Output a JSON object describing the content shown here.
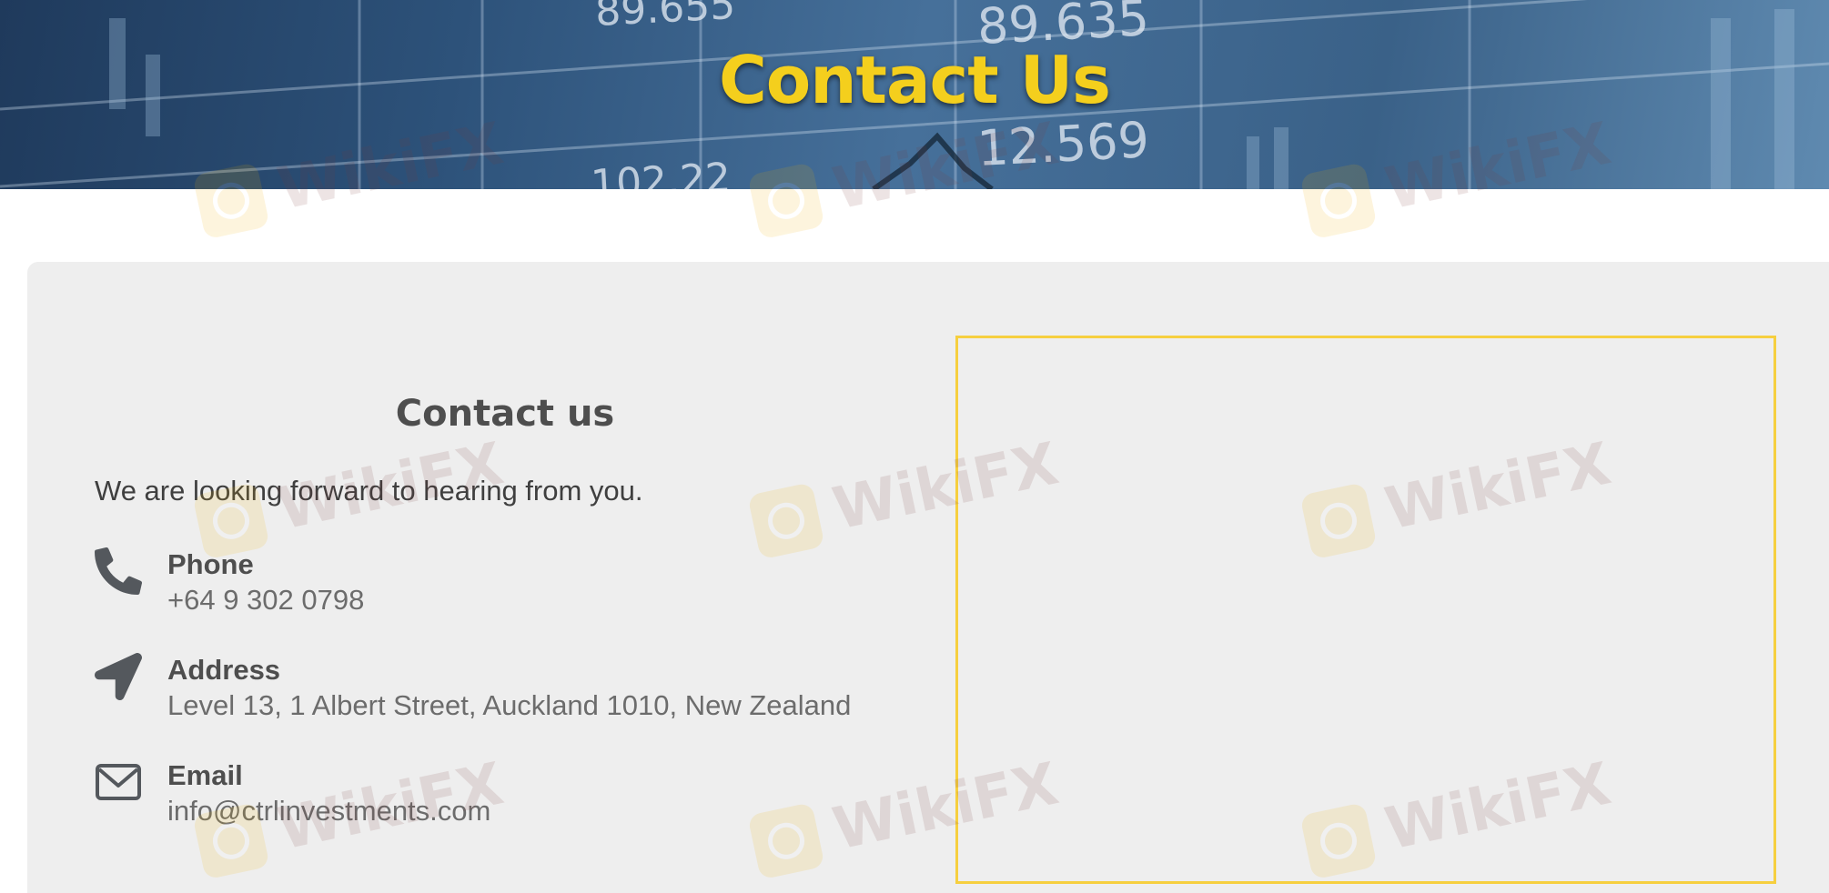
{
  "hero": {
    "title": "Contact Us",
    "background_numbers": [
      "89.655",
      "89.635",
      "12.569",
      "102.22"
    ]
  },
  "contact": {
    "heading": "Contact us",
    "intro": "We are looking forward to hearing from you.",
    "items": [
      {
        "label": "Phone",
        "value": "+64 9 302 0798",
        "icon": "phone-icon"
      },
      {
        "label": "Address",
        "value": "Level 13, 1 Albert Street, Auckland 1010, New Zealand",
        "icon": "location-arrow-icon"
      },
      {
        "label": "Email",
        "value": "info@ctrlinvestments.com",
        "icon": "envelope-icon"
      }
    ]
  },
  "watermark": {
    "text": "WikiFX"
  },
  "colors": {
    "title_yellow": "#f4cf1d",
    "card_background": "#eeeeee",
    "map_border": "#f6cf3f",
    "heading_text": "#4e4e4e",
    "value_text": "#6c6c6c"
  }
}
